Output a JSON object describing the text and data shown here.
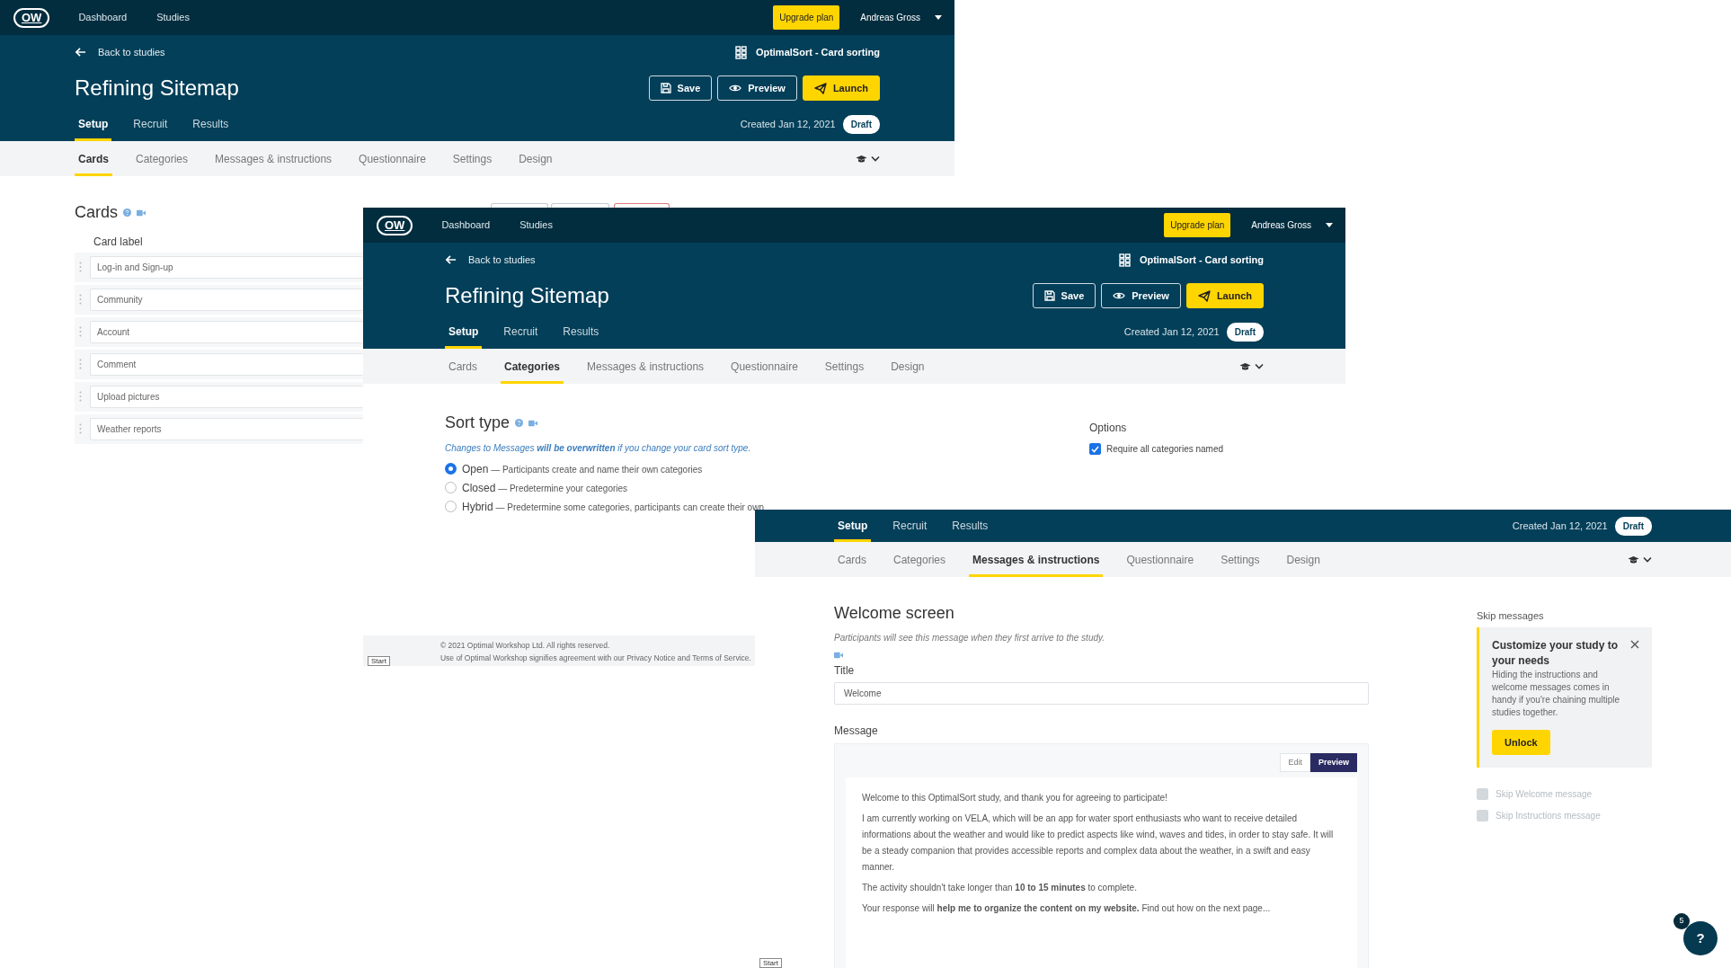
{
  "windows": [
    {
      "topbar": {
        "logo": "OW",
        "links": [
          "Dashboard",
          "Studies"
        ],
        "upgrade": "Upgrade plan",
        "user": "Andreas Gross"
      },
      "header": {
        "back": "Back to studies",
        "product": "OptimalSort - Card sorting",
        "title": "Refining Sitemap",
        "buttons": [
          {
            "label": "Save",
            "kind": "save"
          },
          {
            "label": "Preview",
            "kind": "preview"
          },
          {
            "label": "Launch",
            "kind": "launch"
          }
        ]
      },
      "tabs": [
        {
          "label": "Setup",
          "selected": true
        },
        {
          "label": "Recruit",
          "selected": false
        },
        {
          "label": "Results",
          "selected": false
        }
      ],
      "created": "Created Jan 12, 2021",
      "status": "Draft",
      "subtabs": [
        {
          "label": "Cards",
          "selected": true
        },
        {
          "label": "Categories",
          "selected": false
        },
        {
          "label": "Messages & instructions",
          "selected": false
        },
        {
          "label": "Questionnaire",
          "selected": false
        },
        {
          "label": "Settings",
          "selected": false
        },
        {
          "label": "Design",
          "selected": false
        }
      ],
      "content": {
        "kind": "cards",
        "heading": "Cards",
        "column": "Card label",
        "cards": [
          "Log-in and Sign-up",
          "Community",
          "Account",
          "Comment",
          "Upload pictures",
          "Weather reports"
        ]
      }
    },
    {
      "topbar": {
        "logo": "OW",
        "links": [
          "Dashboard",
          "Studies"
        ],
        "upgrade": "Upgrade plan",
        "user": "Andreas Gross"
      },
      "header": {
        "back": "Back to studies",
        "product": "OptimalSort - Card sorting",
        "title": "Refining Sitemap",
        "buttons": [
          {
            "label": "Save",
            "kind": "save"
          },
          {
            "label": "Preview",
            "kind": "preview"
          },
          {
            "label": "Launch",
            "kind": "launch"
          }
        ]
      },
      "tabs": [
        {
          "label": "Setup",
          "selected": true
        },
        {
          "label": "Recruit",
          "selected": false
        },
        {
          "label": "Results",
          "selected": false
        }
      ],
      "created": "Created Jan 12, 2021",
      "status": "Draft",
      "subtabs": [
        {
          "label": "Cards",
          "selected": false
        },
        {
          "label": "Categories",
          "selected": true
        },
        {
          "label": "Messages & instructions",
          "selected": false
        },
        {
          "label": "Questionnaire",
          "selected": false
        },
        {
          "label": "Settings",
          "selected": false
        },
        {
          "label": "Design",
          "selected": false
        }
      ],
      "content": {
        "kind": "sort_type",
        "heading": "Sort type",
        "note": "Changes to Messages **will be overwritten** if you change your card sort type.",
        "options": [
          {
            "label": "Open",
            "description": "— Participants create and name their own categories",
            "selected": true
          },
          {
            "label": "Closed",
            "description": "— Predetermine your categories",
            "selected": false
          },
          {
            "label": "Hybrid",
            "description": "— Predetermine some categories, participants can create their own",
            "selected": false
          }
        ],
        "side": {
          "heading": "Options",
          "checks": [
            {
              "label": "Require all categories named",
              "checked": true,
              "disabled": false
            }
          ]
        }
      },
      "footer": {
        "copyright": "© 2021 Optimal Workshop Ltd. All rights reserved.",
        "terms_start": "Use of Optimal Workshop signifies agreement with our",
        "privacy": "Privacy Notice",
        "terms_middle": "and",
        "terms": "Terms of Service",
        "terms_end": "."
      },
      "start": "Start"
    },
    {
      "tabs": [
        {
          "label": "Setup",
          "selected": true
        },
        {
          "label": "Recruit",
          "selected": false
        },
        {
          "label": "Results",
          "selected": false
        }
      ],
      "created": "Created Jan 12, 2021",
      "status": "Draft",
      "subtabs": [
        {
          "label": "Cards",
          "selected": false
        },
        {
          "label": "Categories",
          "selected": false
        },
        {
          "label": "Messages & instructions",
          "selected": true
        },
        {
          "label": "Questionnaire",
          "selected": false
        },
        {
          "label": "Settings",
          "selected": false
        },
        {
          "label": "Design",
          "selected": false
        }
      ],
      "content": {
        "kind": "welcome",
        "heading": "Welcome screen",
        "note": "Participants will see this message when they first arrive to the study.",
        "title_label": "Title",
        "title_value": "Welcome",
        "message_label": "Message",
        "modes": [
          {
            "label": "Edit",
            "selected": false
          },
          {
            "label": "Preview",
            "selected": true
          }
        ],
        "paragraphs": [
          "Welcome to this OptimalSort study, and thank you for agreeing to participate!",
          "I am currently working on VELA, which will be an app for water sport enthusiasts who want to receive detailed informations about the weather and would like to predict aspects like wind, waves and tides, in order to stay safe. It will be a steady companion that provides accessible reports and complex data about the weather, in a swift and easy manner.",
          "The activity shouldn't take longer than **10 to 15 minutes** to complete.",
          "Your response will **help me to organize the content on my website.** Find out how on the next page..."
        ],
        "side": {
          "heading": "Skip messages",
          "callout": {
            "title": "Customize your study to your needs",
            "text": "Hiding the instructions and welcome messages comes in handy if you're chaining multiple studies together.",
            "button": "Unlock"
          },
          "checks": [
            {
              "label": "Skip Welcome message",
              "checked": false,
              "disabled": true
            },
            {
              "label": "Skip Instructions message",
              "checked": false,
              "disabled": true
            }
          ]
        }
      },
      "start": "Start"
    }
  ],
  "help": {
    "badge": "5",
    "label": "?"
  }
}
